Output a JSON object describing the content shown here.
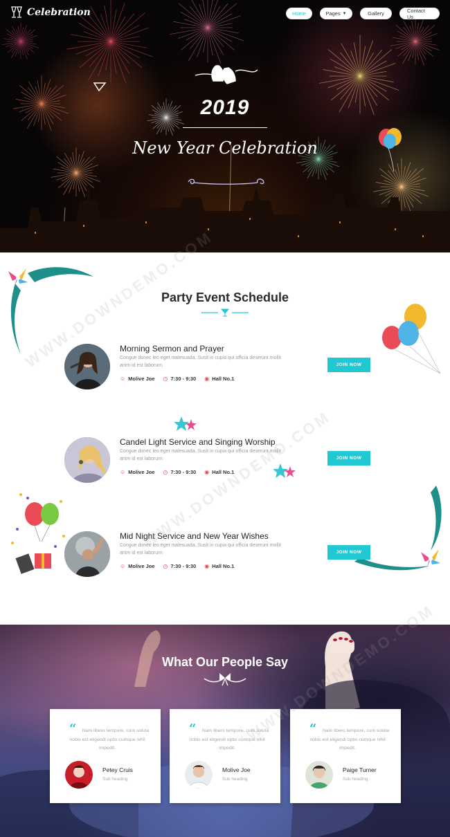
{
  "nav": {
    "logo": "Celebration",
    "items": [
      {
        "label": "Home",
        "active": true
      },
      {
        "label": "Pages",
        "dropdown": true
      },
      {
        "label": "Gallery"
      },
      {
        "label": "Contact Us"
      }
    ]
  },
  "hero": {
    "year": "2019",
    "subtitle": "New Year Celebration"
  },
  "schedule": {
    "title": "Party Event Schedule",
    "events": [
      {
        "title": "Morning Sermon and Prayer",
        "description": "Congue donec leo eget malesuada. Susit in cupia qui officia deserunt mollit anim id est laborum.",
        "host": "Molive Joe",
        "time": "7:30 - 9:30",
        "place": "Hall No.1",
        "button": "JOIN NOW"
      },
      {
        "title": "Candel Light Service and Singing Worship",
        "description": "Congue donec leo eget malesuada. Susit in cupia qui officia deserunt mollit anim id est laborum.",
        "host": "Molive Joe",
        "time": "7:30 - 9:30",
        "place": "Hall No.1",
        "button": "JOIN NOW"
      },
      {
        "title": "Mid Night Service and New Year Wishes",
        "description": "Congue donec leo eget malesuada. Susit in cupia qui officia deserunt mollit anim id est laborum.",
        "host": "Molive Joe",
        "time": "7:30 - 9:30",
        "place": "Hall No.1",
        "button": "JOIN NOW"
      }
    ]
  },
  "testimonials": {
    "title": "What Our People Say",
    "items": [
      {
        "quote": "Nam libero tempore, cum soluta nobis est eligendi optio cumque nihil impedit.",
        "name": "Petey Cruis",
        "role": "Sub heading"
      },
      {
        "quote": "Nam libero tempore, cum soluta nobis est eligendi optio cumque nihil impedit.",
        "name": "Molive Joe",
        "role": "Sub heading"
      },
      {
        "quote": "Nam libero tempore, cum soluta nobis est eligendi optio cumque nihil impedit.",
        "name": "Paige Turner",
        "role": "Sub heading"
      }
    ]
  },
  "watermark": "WWW.DOWNDEMO.COM",
  "colors": {
    "accent": "#22c8d1",
    "icon": "#e0474c"
  }
}
